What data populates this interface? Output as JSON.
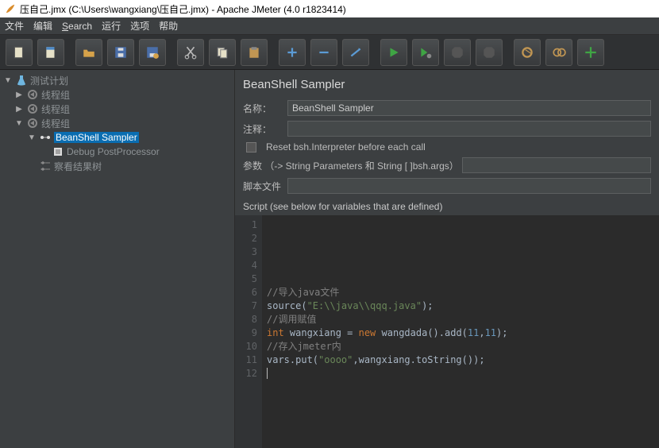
{
  "window": {
    "title": "压自己.jmx (C:\\Users\\wangxiang\\压自己.jmx) - Apache JMeter (4.0 r1823414)"
  },
  "menu": {
    "file": "文件",
    "edit": "编辑",
    "search": "Search",
    "run": "运行",
    "options": "选项",
    "help": "帮助"
  },
  "tree": {
    "plan": "测试计划",
    "tg1": "线程组",
    "tg2": "线程组",
    "tg3": "线程组",
    "bsh": "BeanShell Sampler",
    "dbg": "Debug PostProcessor",
    "viewtree": "察看结果树"
  },
  "panel": {
    "title": "BeanShell Sampler",
    "name_label": "名称：",
    "name_value": "BeanShell Sampler",
    "comment_label": "注释：",
    "comment_value": "",
    "reset_label": "Reset bsh.Interpreter before each call",
    "params_label": "参数 （-> String Parameters 和 String [ ]bsh.args）",
    "params_value": "",
    "scriptfile_label": "脚本文件",
    "scriptfile_value": "",
    "script_section": "Script (see below for variables that are defined)"
  },
  "code": {
    "l1": "",
    "l2": "",
    "l3": "",
    "l4": "",
    "l5": "",
    "c6": "//导入java文件",
    "l7a": "source(",
    "l7b": "\"E:\\\\java\\\\qqq.java\"",
    "l7c": ");",
    "c8": "//调用赋值",
    "l9a": "int",
    "l9b": " wangxiang = ",
    "l9c": "new",
    "l9d": " wangdada().add(",
    "l9e": "11",
    "l9f": ",",
    "l9g": "11",
    "l9h": ");",
    "c10": "//存入jmeter内",
    "l11a": "vars.put(",
    "l11b": "\"oooo\"",
    "l11c": ",wangxiang.toString());",
    "l12": ""
  },
  "gutter": [
    "1",
    "2",
    "3",
    "4",
    "5",
    "6",
    "7",
    "8",
    "9",
    "10",
    "11",
    "12"
  ]
}
